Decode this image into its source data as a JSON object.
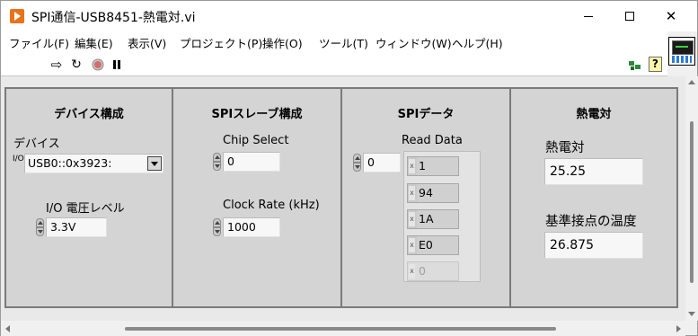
{
  "window": {
    "title": "SPI通信-USB8451-熱電対.vi"
  },
  "menu": [
    "ファイル(F)",
    "編集(E)",
    "表示(V)",
    "プロジェクト(P)",
    "操作(O)",
    "ツール(T)",
    "ウィンドウ(W)",
    "ヘルプ(H)"
  ],
  "toolbar": {
    "run_icon": "⇨",
    "run_continuous_icon": "↻",
    "help_icon_text": "?"
  },
  "device_config": {
    "title": "デバイス構成",
    "device_label": "デバイス",
    "device_ring_glyph": "I/O",
    "device_value": "USB0::0x3923:",
    "io_voltage_label": "I/O 電圧レベル",
    "io_voltage_value": "3.3V"
  },
  "spi_slave_config": {
    "title": "SPIスレーブ構成",
    "chip_select_label": "Chip Select",
    "chip_select_value": "0",
    "clock_rate_label": "Clock Rate (kHz)",
    "clock_rate_value": "1000"
  },
  "spi_data": {
    "title": "SPIデータ",
    "read_data_label": "Read Data",
    "index_value": "0",
    "element_prefix": "x",
    "elements": [
      "1",
      "94",
      "1A",
      "E0",
      "0"
    ]
  },
  "thermocouple": {
    "title": "熱電対",
    "thermocouple_label": "熱電対",
    "thermocouple_value": "25.25",
    "cold_junction_label": "基準接点の温度",
    "cold_junction_value": "26.875"
  },
  "colors": {
    "cluster_bg": "#d4d4d4",
    "panel_bg": "#e9e9e9",
    "app_icon": "#e8731a"
  }
}
